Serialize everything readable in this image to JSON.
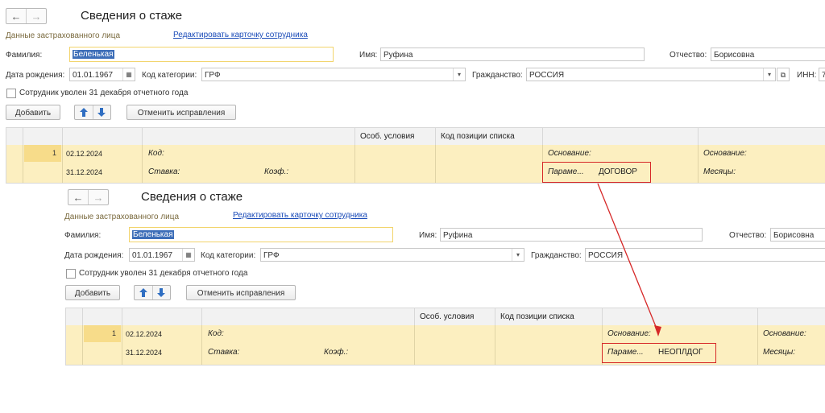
{
  "nav": {
    "back_label": "←",
    "forward_label": "→"
  },
  "title": "Сведения о стаже",
  "section_title": "Данные застрахованного лица",
  "edit_link": "Редактировать карточку сотрудника",
  "fields": {
    "surname_label": "Фамилия:",
    "surname_value": "Беленькая",
    "name_label": "Имя:",
    "name_value": "Руфина",
    "patronymic_label": "Отчество:",
    "patronymic_value": "Борисовна",
    "birth_label": "Дата рождения:",
    "birth_value": "01.01.1967",
    "category_label": "Код категории:",
    "category_value": "ГРФ",
    "citizenship_label": "Гражданство:",
    "citizenship_value": "РОССИЯ",
    "inn_label": "ИНН:",
    "inn_value": "7"
  },
  "dismissed_label": "Сотрудник уволен 31 декабря отчетного года",
  "buttons": {
    "add": "Добавить",
    "cancel_edits": "Отменить исправления"
  },
  "icons": {
    "up": "arrow-up-icon",
    "down": "arrow-down-icon",
    "calendar": "calendar-icon",
    "dropdown": "dropdown-icon",
    "open": "open-icon"
  },
  "grid": {
    "headers": [
      "Особ. условия",
      "Код позиции списка"
    ],
    "row": {
      "num": "1",
      "date_start": "02.12.2024",
      "date_end": "31.12.2024",
      "code": "Код:",
      "rate": "Ставка:",
      "coef": "Коэф.:",
      "basis": "Основание:",
      "param": "Параме...",
      "basis2": "Основание:",
      "months": "Месяцы:"
    }
  },
  "before": {
    "param_value": "ДОГОВОР"
  },
  "after": {
    "param_value": "НЕОПЛДОГ"
  },
  "colors": {
    "highlight": "#d62828",
    "row": "#fcefc0",
    "link": "#1a4bb8"
  }
}
